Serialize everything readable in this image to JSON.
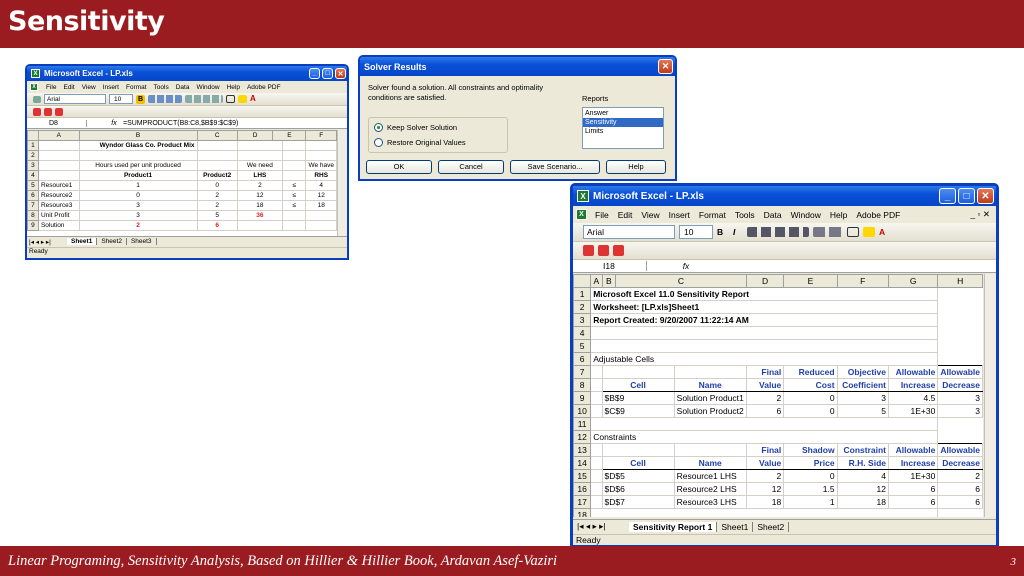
{
  "slide": {
    "title": "Sensitivity",
    "footer": "Linear Programing, Sensitivity Analysis, Based on Hillier & Hillier Book, Ardavan Asef-Vaziri",
    "page": "3"
  },
  "excel1": {
    "title": "Microsoft Excel - LP.xls",
    "menus": [
      "File",
      "Edit",
      "View",
      "Insert",
      "Format",
      "Tools",
      "Data",
      "Window",
      "Help",
      "Adobe PDF"
    ],
    "font": "Arial",
    "size": "10",
    "cellref": "D8",
    "formula": "=SUMPRODUCT(B8:C8,$B$9:$C$9)",
    "cols": [
      "A",
      "B",
      "C",
      "D",
      "E",
      "F"
    ],
    "rows": [
      {
        "n": "1",
        "a": "",
        "b": "Wyndor Glass Co. Product Mix",
        "c": "",
        "d": "",
        "e": "",
        "f": ""
      },
      {
        "n": "2",
        "a": "",
        "b": "",
        "c": "",
        "d": "",
        "e": "",
        "f": ""
      },
      {
        "n": "3",
        "a": "",
        "b": "Hours used per unit produced",
        "c": "",
        "d": "We need",
        "e": "",
        "f": "We have"
      },
      {
        "n": "4",
        "a": "",
        "b": "Product1",
        "c": "Product2",
        "d": "LHS",
        "e": "",
        "f": "RHS"
      },
      {
        "n": "5",
        "a": "Resource1",
        "b": "1",
        "c": "0",
        "d": "2",
        "e": "≤",
        "f": "4"
      },
      {
        "n": "6",
        "a": "Resource2",
        "b": "0",
        "c": "2",
        "d": "12",
        "e": "≤",
        "f": "12"
      },
      {
        "n": "7",
        "a": "Resource3",
        "b": "3",
        "c": "2",
        "d": "18",
        "e": "≤",
        "f": "18"
      },
      {
        "n": "8",
        "a": "Unit Profit",
        "b": "3",
        "c": "5",
        "d": "36",
        "e": "",
        "f": ""
      },
      {
        "n": "9",
        "a": "Solution",
        "b": "2",
        "c": "6",
        "d": "",
        "e": "",
        "f": ""
      }
    ],
    "tabs": [
      "Sheet1",
      "Sheet2",
      "Sheet3"
    ],
    "status": "Ready"
  },
  "solver": {
    "title": "Solver Results",
    "message": "Solver found a solution.  All constraints and optimality conditions are satisfied.",
    "reports_label": "Reports",
    "reports": [
      "Answer",
      "Sensitivity",
      "Limits"
    ],
    "keep": "Keep Solver Solution",
    "restore": "Restore Original Values",
    "ok": "OK",
    "cancel": "Cancel",
    "save": "Save Scenario...",
    "help": "Help"
  },
  "excel2": {
    "title": "Microsoft Excel - LP.xls",
    "menus": [
      "File",
      "Edit",
      "View",
      "Insert",
      "Format",
      "Tools",
      "Data",
      "Window",
      "Help",
      "Adobe PDF"
    ],
    "font": "Arial",
    "size": "10",
    "cellref": "I18",
    "formula": "",
    "cols": [
      "A",
      "B",
      "C",
      "D",
      "E",
      "F",
      "G",
      "H"
    ],
    "rows": [
      {
        "n": "1",
        "t": "Microsoft Excel 11.0 Sensitivity Report"
      },
      {
        "n": "2",
        "t": "Worksheet: [LP.xls]Sheet1"
      },
      {
        "n": "3",
        "t": "Report Created: 9/20/2007 11:22:14 AM"
      },
      {
        "n": "4",
        "t": ""
      },
      {
        "n": "5",
        "t": ""
      },
      {
        "n": "6",
        "t": "Adjustable Cells"
      },
      {
        "n": "7",
        "h": [
          "",
          "",
          "Final",
          "Reduced",
          "Objective",
          "Allowable",
          "Allowable"
        ]
      },
      {
        "n": "8",
        "h": [
          "Cell",
          "Name",
          "Value",
          "Cost",
          "Coefficient",
          "Increase",
          "Decrease"
        ]
      },
      {
        "n": "9",
        "v": [
          "$B$9",
          "Solution Product1",
          "2",
          "0",
          "3",
          "4.5",
          "3"
        ]
      },
      {
        "n": "10",
        "v": [
          "$C$9",
          "Solution Product2",
          "6",
          "0",
          "5",
          "1E+30",
          "3"
        ]
      },
      {
        "n": "11",
        "t": ""
      },
      {
        "n": "12",
        "t": "Constraints"
      },
      {
        "n": "13",
        "h": [
          "",
          "",
          "Final",
          "Shadow",
          "Constraint",
          "Allowable",
          "Allowable"
        ]
      },
      {
        "n": "14",
        "h": [
          "Cell",
          "Name",
          "Value",
          "Price",
          "R.H. Side",
          "Increase",
          "Decrease"
        ]
      },
      {
        "n": "15",
        "v": [
          "$D$5",
          "Resource1 LHS",
          "2",
          "0",
          "4",
          "1E+30",
          "2"
        ]
      },
      {
        "n": "16",
        "v": [
          "$D$6",
          "Resource2 LHS",
          "12",
          "1.5",
          "12",
          "6",
          "6"
        ]
      },
      {
        "n": "17",
        "v": [
          "$D$7",
          "Resource3 LHS",
          "18",
          "1",
          "18",
          "6",
          "6"
        ]
      },
      {
        "n": "18",
        "t": ""
      }
    ],
    "tabs": [
      "Sensitivity Report 1",
      "Sheet1",
      "Sheet2"
    ],
    "status": "Ready"
  }
}
